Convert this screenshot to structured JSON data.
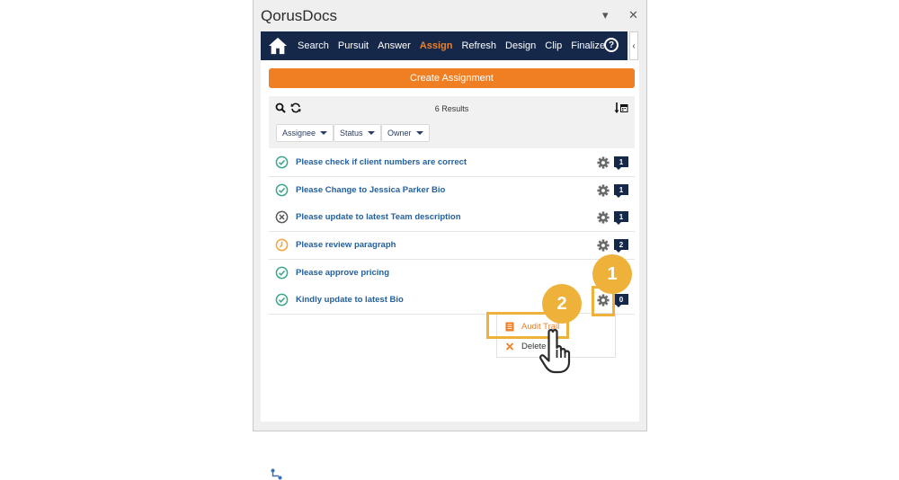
{
  "pane": {
    "title": "QorusDocs",
    "menu_glyph": "▾",
    "close_glyph": "✕"
  },
  "nav": {
    "items": [
      "Search",
      "Pursuit",
      "Answer",
      "Assign",
      "Refresh",
      "Design",
      "Clip",
      "Finalize"
    ],
    "active": "Assign",
    "help_glyph": "?",
    "collapse_glyph": "‹"
  },
  "create_button": "Create Assignment",
  "toolbar": {
    "results": "6 Results"
  },
  "filters": [
    "Assignee",
    "Status",
    "Owner"
  ],
  "assignments": [
    {
      "label": "Please check if client numbers are correct",
      "status": "done",
      "count": "1"
    },
    {
      "label": "Please Change to Jessica Parker Bio",
      "status": "done",
      "count": "1"
    },
    {
      "label": "Please update to latest Team description",
      "status": "rejected",
      "count": "1"
    },
    {
      "label": "Please review paragraph",
      "status": "pending",
      "count": "2"
    },
    {
      "label": "Please approve pricing",
      "status": "done",
      "count": ""
    },
    {
      "label": "Kindly update to latest Bio",
      "status": "done",
      "count": "0"
    }
  ],
  "context_menu": {
    "audit_trail": "Audit Trail",
    "delete": "Delete"
  },
  "callouts": {
    "step1": "1",
    "step2": "2"
  },
  "colors": {
    "navy": "#16284a",
    "orange": "#f07f24",
    "link": "#24609e",
    "done": "#3aa68d",
    "pending": "#f3a43a",
    "callout": "#eeb23a"
  },
  "icons": [
    "home-icon",
    "help-icon",
    "search-icon",
    "refresh-icon",
    "sort-calendar-icon",
    "check-circle-icon",
    "x-circle-icon",
    "clock-icon",
    "gear-icon",
    "comment-badge",
    "document-icon",
    "delete-icon",
    "pointer-hand-icon",
    "link-icon"
  ]
}
